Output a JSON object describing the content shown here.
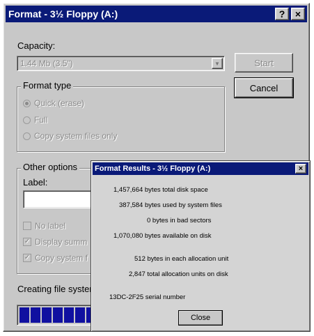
{
  "main_window": {
    "title": "Format - 3½ Floppy (A:)",
    "help_button": "?",
    "close_button": "×",
    "capacity_label": "Capacity:",
    "capacity_value": "1.44 Mb (3.5\")",
    "start_button": "Start",
    "cancel_button": "Cancel",
    "format_type": {
      "title": "Format type",
      "options": [
        "Quick (erase)",
        "Full",
        "Copy system files only"
      ]
    },
    "other_options": {
      "title": "Other options",
      "label_label": "Label:",
      "checkboxes": [
        "No label",
        "Display summ",
        "Copy system f"
      ]
    },
    "status_text": "Creating file system",
    "progress_blocks": 7
  },
  "results_dialog": {
    "title": "Format Results - 3½ Floppy (A:)",
    "close_x": "×",
    "lines": [
      "1,457,664 bytes total disk space",
      "387,584 bytes used by system files",
      "0 bytes in bad sectors",
      "1,070,080 bytes available on disk",
      "512 bytes in each allocation unit",
      "2,847 total allocation units on disk",
      "13DC-2F25 serial number"
    ],
    "close_button": "Close"
  }
}
